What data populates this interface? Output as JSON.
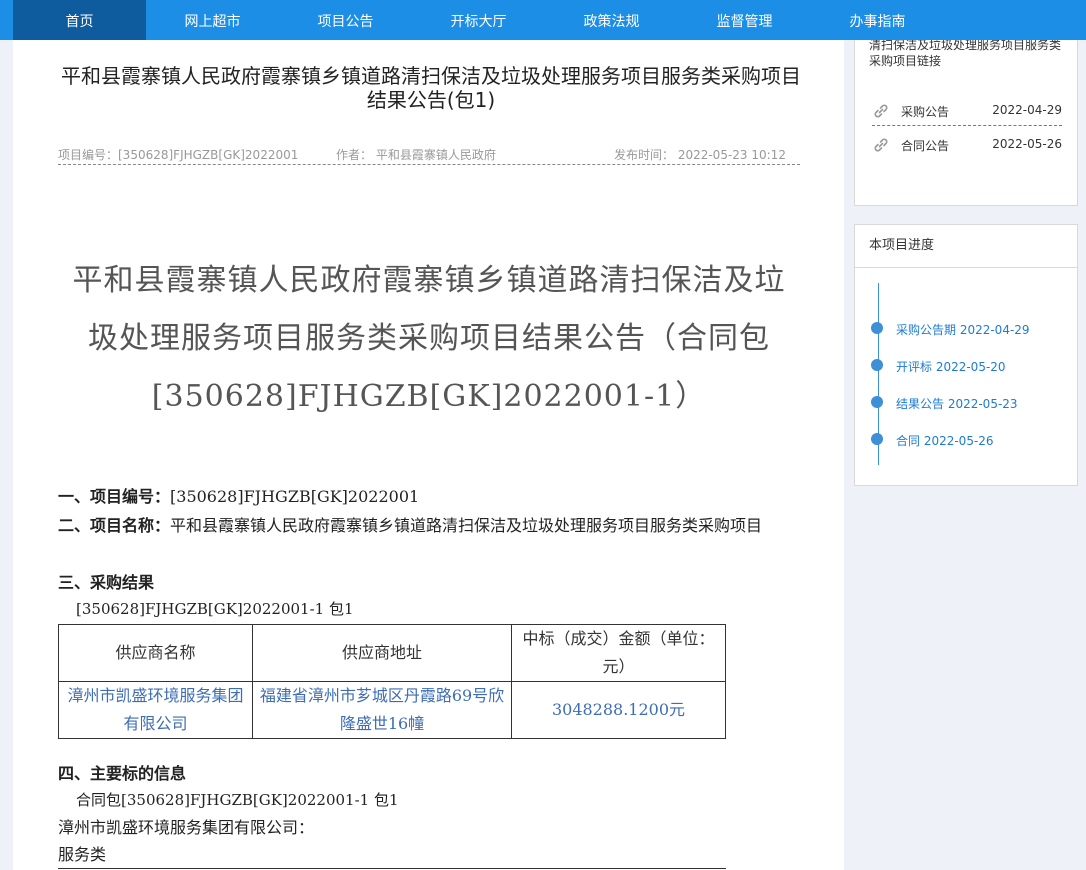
{
  "nav": {
    "items": [
      {
        "label": "首页",
        "active": true
      },
      {
        "label": "网上超市"
      },
      {
        "label": "项目公告"
      },
      {
        "label": "开标大厅"
      },
      {
        "label": "政策法规"
      },
      {
        "label": "监督管理"
      },
      {
        "label": "办事指南"
      }
    ]
  },
  "article": {
    "title": "平和县霞寨镇人民政府霞寨镇乡镇道路清扫保洁及垃圾处理服务项目服务类采购项目结果公告(包1)",
    "meta": {
      "project_no": "项目编号：[350628]FJHGZB[GK]2022001",
      "author": "作者：  平和县霞寨镇人民政府",
      "publish_time": "发布时间：  2022-05-23 10:12"
    },
    "big_title": "平和县霞寨镇人民政府霞寨镇乡镇道路清扫保洁及垃圾处理服务项目服务类采购项目结果公告（合同包[350628]FJHGZB[GK]2022001-1）",
    "sec1_label": "一、项目编号：",
    "sec1_value": "[350628]FJHGZB[GK]2022001",
    "sec2_label": "二、项目名称：",
    "sec2_value": "平和县霞寨镇人民政府霞寨镇乡镇道路清扫保洁及垃圾处理服务项目服务类采购项目",
    "sec3_label": "三、采购结果",
    "sec3_sub": "[350628]FJHGZB[GK]2022001-1 包1",
    "table": {
      "headers": [
        "供应商名称",
        "供应商地址",
        "中标（成交）金额（单位：元）"
      ],
      "rows": [
        [
          "漳州市凯盛环境服务集团有限公司",
          "福建省漳州市芗城区丹霞路69号欣隆盛世16幢",
          "3048288.1200元"
        ]
      ]
    },
    "sec4_label": "四、主要标的信息",
    "sec4_sub": "合同包[350628]FJHGZB[GK]2022001-1 包1",
    "sec4_company": "漳州市凯盛环境服务集团有限公司：",
    "sec4_type": "服务类"
  },
  "sidebar": {
    "links_title": "清扫保洁及垃圾处理服务项目服务类采购项目链接",
    "links": [
      {
        "label": "采购公告",
        "date": "2022-04-29"
      },
      {
        "label": "合同公告",
        "date": "2022-05-26"
      }
    ],
    "progress_title": "本项目进度",
    "progress": [
      {
        "label": "采购公告期 2022-04-29"
      },
      {
        "label": "开评标 2022-05-20"
      },
      {
        "label": "结果公告 2022-05-23"
      },
      {
        "label": "合同 2022-05-26"
      }
    ],
    "accent_color": "#1d8ee6"
  }
}
